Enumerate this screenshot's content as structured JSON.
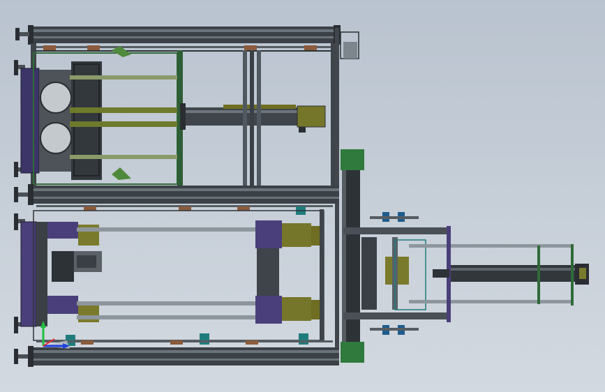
{
  "view": {
    "background_top": "#b9c3cf",
    "background_bottom": "#d3d9e0"
  },
  "colors": {
    "steel_dark": "#2b2f33",
    "steel_mid": "#5e656c",
    "steel_light": "#8d959c",
    "rail": "#3c4247",
    "purple_plate": "#4a3f7a",
    "olive_block": "#77762a",
    "green_plate": "#2f7a3c",
    "teal_part": "#1f7c7c",
    "brown_pad": "#8a5b3c",
    "rod": "#9aa1a8",
    "cylinder": "#3a3f45",
    "axis_x": "#2040e0",
    "axis_y": "#20c040",
    "axis_z": "#e03030"
  },
  "triad": {
    "icon": "coordinate-triad-icon",
    "axes": [
      "x",
      "y",
      "z"
    ]
  }
}
